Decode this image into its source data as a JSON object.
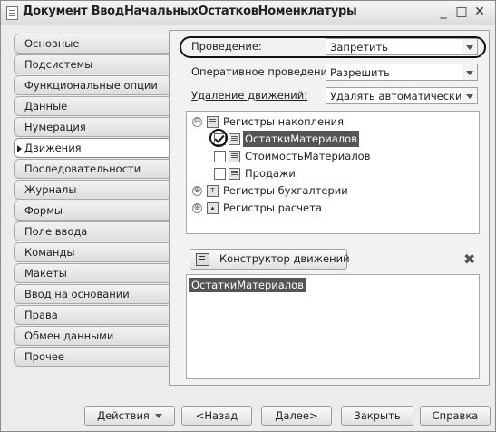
{
  "window": {
    "title": "Документ ВводНачальныхОстатковНоменклатуры",
    "minimize_glyph": "_",
    "maximize_glyph": "□",
    "close_glyph": "✕"
  },
  "tabs": [
    {
      "label": "Основные"
    },
    {
      "label": "Подсистемы"
    },
    {
      "label": "Функциональные опции"
    },
    {
      "label": "Данные"
    },
    {
      "label": "Нумерация"
    },
    {
      "label": "Движения",
      "active": true
    },
    {
      "label": "Последовательности"
    },
    {
      "label": "Журналы"
    },
    {
      "label": "Формы"
    },
    {
      "label": "Поле ввода"
    },
    {
      "label": "Команды"
    },
    {
      "label": "Макеты"
    },
    {
      "label": "Ввод на основании"
    },
    {
      "label": "Права"
    },
    {
      "label": "Обмен данными"
    },
    {
      "label": "Прочее"
    }
  ],
  "fields": {
    "posting": {
      "label": "Проведение:",
      "value": "Запретить"
    },
    "realtime_posting": {
      "label": "Оперативное проведение:",
      "value": "Разрешить"
    },
    "delete_movements": {
      "label": "Удаление движений:",
      "value": "Удалять автоматически при"
    }
  },
  "tree": {
    "accumulation_registers": {
      "label": "Регистры накопления",
      "expander": "⊖",
      "icon": "register-icon"
    },
    "items": [
      {
        "label": "ОстаткиМатериалов",
        "checked": true,
        "selected": true
      },
      {
        "label": "СтоимостьМатериалов",
        "checked": false
      },
      {
        "label": "Продажи",
        "checked": false
      }
    ],
    "accounting_registers": {
      "label": "Регистры бухгалтерии",
      "expander": "⊕",
      "icon": "accounting-register-icon"
    },
    "calculation_registers": {
      "label": "Регистры расчета",
      "expander": "⊕",
      "icon": "calculation-register-icon"
    }
  },
  "movement_constructor": {
    "label": "Конструктор движений",
    "delete_glyph": "✖"
  },
  "result_list": {
    "items": [
      "ОстаткиМатериалов"
    ]
  },
  "footer": {
    "actions": "Действия",
    "back": "<Назад",
    "next": "Далее>",
    "close": "Закрыть",
    "help": "Справка"
  },
  "colors": {
    "selection": "#555555",
    "window_bg": "#ececec"
  }
}
